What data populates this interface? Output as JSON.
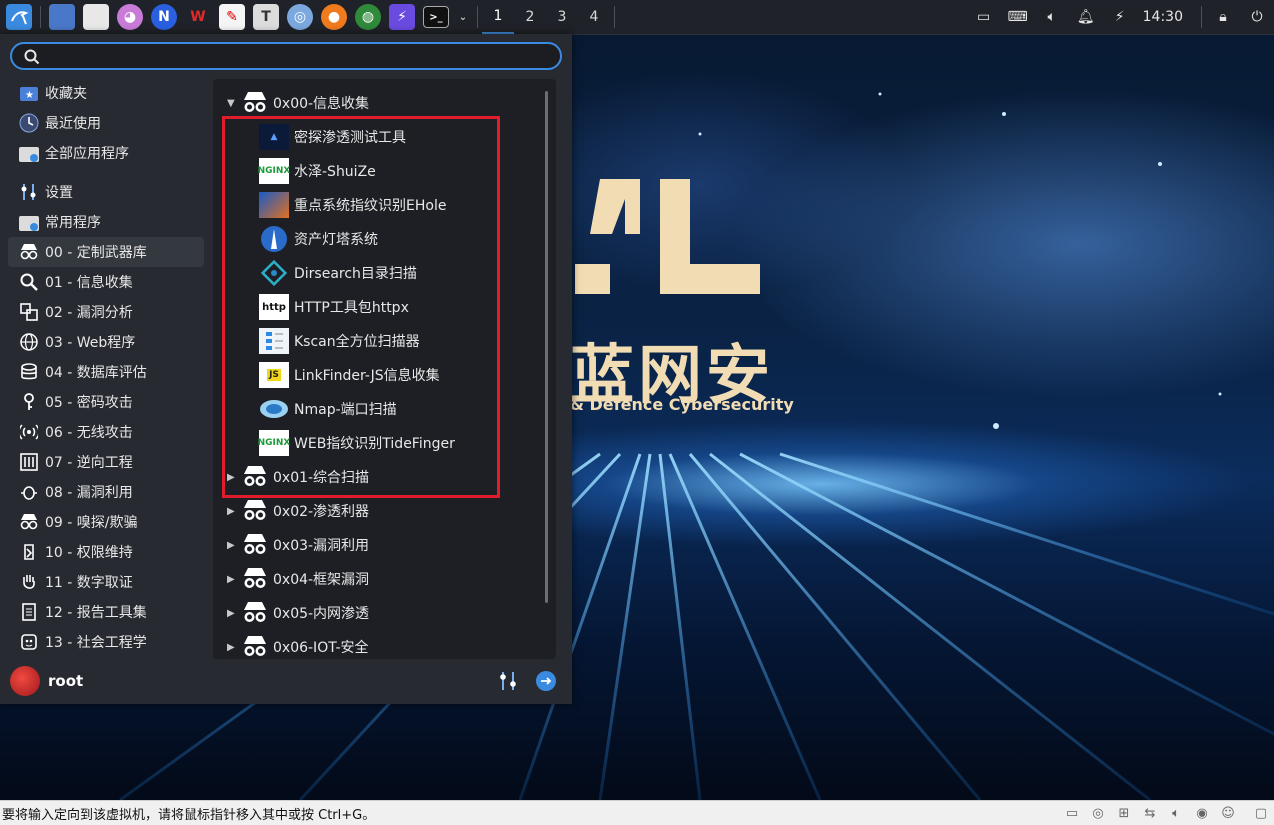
{
  "taskbar": {
    "workspaces": [
      "1",
      "2",
      "3",
      "4"
    ],
    "active_workspace": "1",
    "clock": "14:30"
  },
  "menu": {
    "search": {
      "value": "",
      "placeholder": ""
    },
    "categories": [
      {
        "label": "收藏夹",
        "icon": "star-folder-icon"
      },
      {
        "label": "最近使用",
        "icon": "clock-icon"
      },
      {
        "label": "全部应用程序",
        "icon": "folder-icon"
      },
      {
        "label": "设置",
        "icon": "sliders-icon"
      },
      {
        "label": "常用程序",
        "icon": "folder-icon"
      },
      {
        "label": "00 - 定制武器库",
        "icon": "spy-icon"
      },
      {
        "label": "01 - 信息收集",
        "icon": "magnifier-icon"
      },
      {
        "label": "02 - 漏洞分析",
        "icon": "vuln-icon"
      },
      {
        "label": "03 - Web程序",
        "icon": "globe-icon"
      },
      {
        "label": "04 - 数据库评估",
        "icon": "database-icon"
      },
      {
        "label": "05 - 密码攻击",
        "icon": "key-icon"
      },
      {
        "label": "06 - 无线攻击",
        "icon": "wireless-icon"
      },
      {
        "label": "07 - 逆向工程",
        "icon": "chip-icon"
      },
      {
        "label": "08 - 漏洞利用",
        "icon": "bug-icon"
      },
      {
        "label": "09 - 嗅探/欺骗",
        "icon": "sniff-icon"
      },
      {
        "label": "10 - 权限维持",
        "icon": "persistence-icon"
      },
      {
        "label": "11 - 数字取证",
        "icon": "hand-icon"
      },
      {
        "label": "12 - 报告工具集",
        "icon": "report-icon"
      },
      {
        "label": "13 - 社会工程学",
        "icon": "social-icon"
      }
    ],
    "groups": [
      {
        "label": "0x00-信息收集",
        "expanded": true
      },
      {
        "label": "0x01-综合扫描"
      },
      {
        "label": "0x02-渗透利器"
      },
      {
        "label": "0x03-漏洞利用"
      },
      {
        "label": "0x04-框架漏洞"
      },
      {
        "label": "0x05-内网渗透"
      },
      {
        "label": "0x06-IOT-安全"
      }
    ],
    "apps": [
      {
        "label": "密探渗透测试工具",
        "icon": "mitan-icon"
      },
      {
        "label": "水泽-ShuiZe",
        "icon": "nginx-icon"
      },
      {
        "label": "重点系统指纹识别EHole",
        "icon": "ehole-icon"
      },
      {
        "label": "资产灯塔系统",
        "icon": "lighthouse-icon"
      },
      {
        "label": "Dirsearch目录扫描",
        "icon": "dirsearch-icon"
      },
      {
        "label": "HTTP工具包httpx",
        "icon": "httpx-icon"
      },
      {
        "label": "Kscan全方位扫描器",
        "icon": "kscan-icon"
      },
      {
        "label": "LinkFinder-JS信息收集",
        "icon": "js-icon"
      },
      {
        "label": "Nmap-端口扫描",
        "icon": "nmap-icon"
      },
      {
        "label": "WEB指纹识别TideFinger",
        "icon": "nginx-icon"
      }
    ],
    "icon_texts": {
      "nginx": "NGINX",
      "httpx": "http",
      "js": "JS"
    },
    "user": "root"
  },
  "wallpaper": {
    "brand": "蓝网安",
    "brand_prefix": "4L",
    "subtitle": "& Defence Cybersecurity"
  },
  "statusbar": {
    "message": "要将输入定向到该虚拟机，请将鼠标指针移入其中或按 Ctrl+G。"
  },
  "colors": {
    "accent": "#3a8be0",
    "highlight": "#e21d2b",
    "brand_gold": "#f2dcb4"
  }
}
